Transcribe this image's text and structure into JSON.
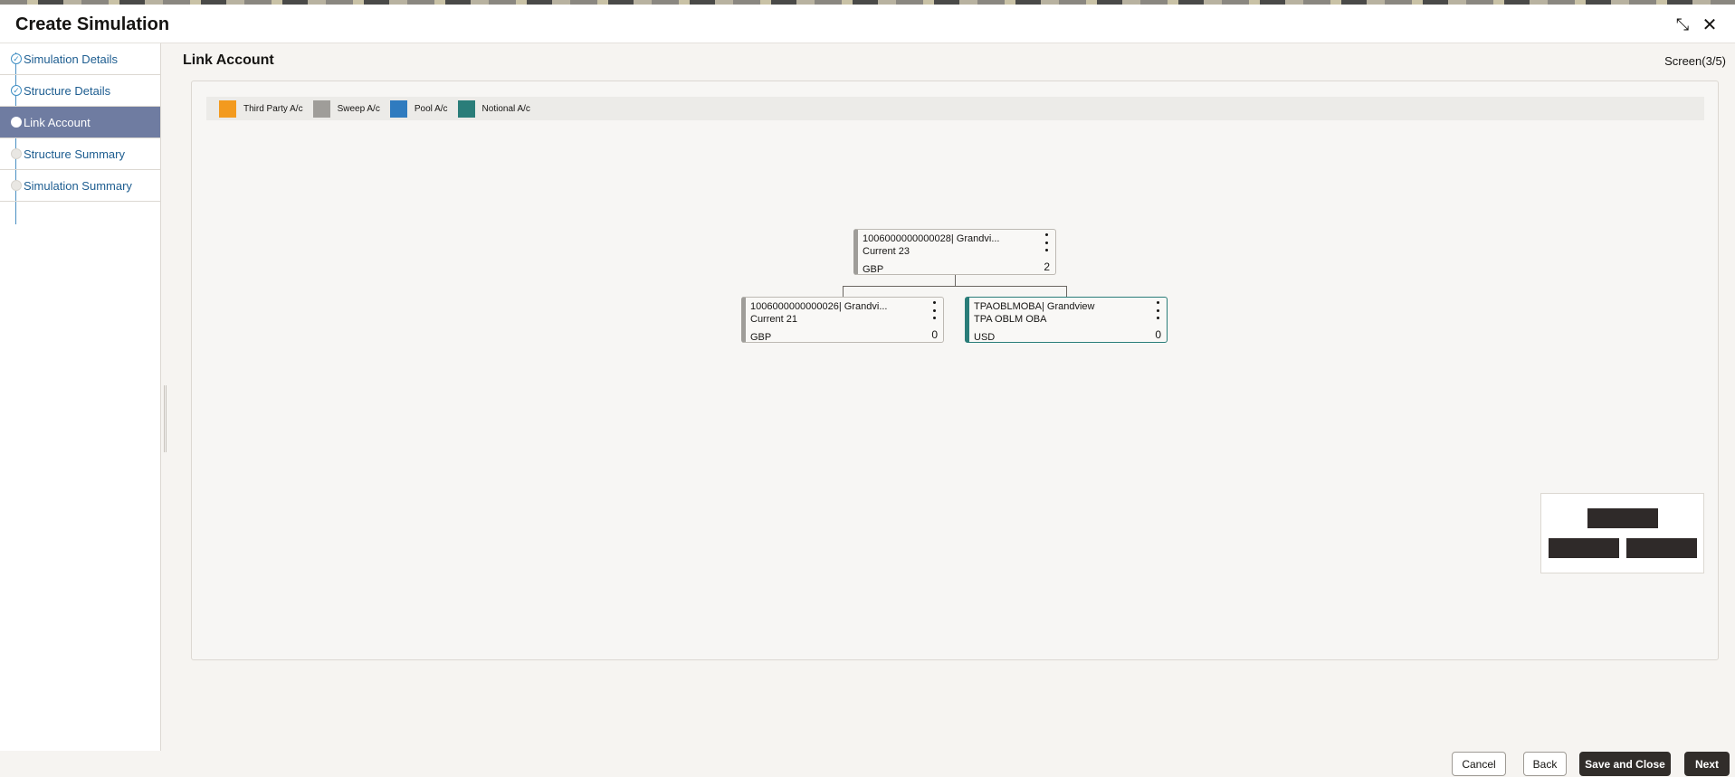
{
  "header": {
    "title": "Create Simulation",
    "minimize_icon": "⤡",
    "close_icon": "✕"
  },
  "sidebar": {
    "steps": [
      {
        "label": "Simulation Details",
        "state": "done"
      },
      {
        "label": "Structure Details",
        "state": "done"
      },
      {
        "label": "Link Account",
        "state": "active"
      },
      {
        "label": "Structure Summary",
        "state": "pending"
      },
      {
        "label": "Simulation Summary",
        "state": "pending"
      }
    ]
  },
  "main": {
    "title": "Link Account",
    "screen_indicator": "Screen(3/5)"
  },
  "legend": [
    {
      "label": "Third Party A/c",
      "color": "#f39a1e"
    },
    {
      "label": "Sweep A/c",
      "color": "#9f9d99"
    },
    {
      "label": "Pool A/c",
      "color": "#2f7bbf"
    },
    {
      "label": "Notional A/c",
      "color": "#2a7d79"
    }
  ],
  "tree": {
    "root": {
      "line1": "1006000000000028| Grandvi...",
      "line2": "Current 23",
      "currency": "GBP",
      "count": "2"
    },
    "children": [
      {
        "line1": "1006000000000026| Grandvi...",
        "line2": "Current 21",
        "currency": "GBP",
        "count": "0"
      },
      {
        "line1": "TPAOBLMOBA| Grandview",
        "line2": "TPA OBLM OBA",
        "currency": "USD",
        "count": "0"
      }
    ]
  },
  "footer": {
    "cancel": "Cancel",
    "back": "Back",
    "save_and_close": "Save and Close",
    "next": "Next"
  }
}
